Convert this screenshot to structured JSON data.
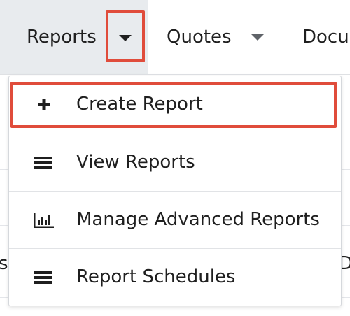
{
  "nav": {
    "tabs": [
      {
        "label": "Reports"
      },
      {
        "label": "Quotes"
      },
      {
        "label": "Docu"
      }
    ]
  },
  "dropdown": {
    "items": [
      {
        "label": "Create Report",
        "icon": "plus-icon"
      },
      {
        "label": "View Reports",
        "icon": "list-icon"
      },
      {
        "label": "Manage Advanced Reports",
        "icon": "bar-chart-icon"
      },
      {
        "label": "Report Schedules",
        "icon": "list-icon"
      }
    ]
  },
  "background": {
    "left_fragment": "es",
    "right_fragment": "Da"
  },
  "colors": {
    "highlight": "#e04c3b",
    "active_tab_bg": "#e8ebee"
  }
}
